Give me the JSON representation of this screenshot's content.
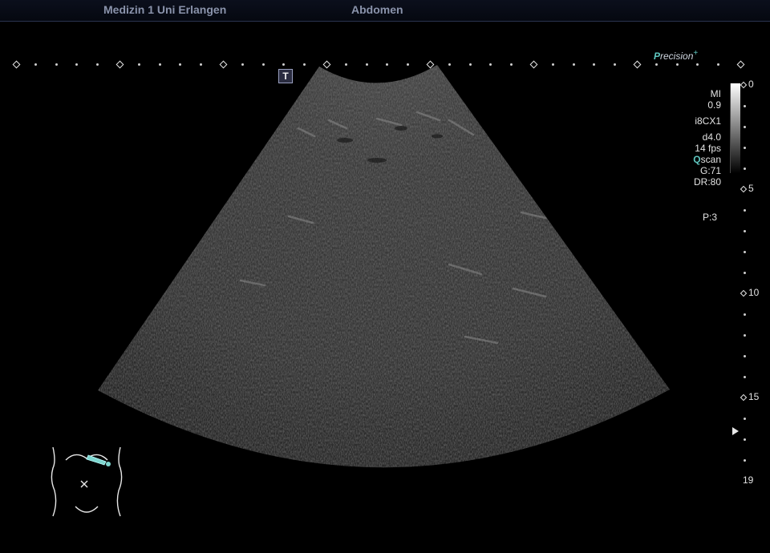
{
  "header": {
    "institution": "Medizin 1 Uni Erlangen",
    "preset": "Abdomen"
  },
  "branding": {
    "precision_first": "P",
    "precision_rest": "recision",
    "precision_plus": "+"
  },
  "tool_marker": "T",
  "parameters": {
    "mi_label": "MI",
    "mi_value": "0.9",
    "probe": "i8CX1",
    "depth": "d4.0",
    "frame_rate": "14 fps",
    "scan_q": "Q",
    "scan_rest": "scan",
    "gain": "G:71",
    "dynamic_range": "DR:80",
    "persistence": "P:3"
  },
  "depth_scale": {
    "labels": [
      "0",
      "5",
      "10",
      "15",
      "19"
    ],
    "unit_ticks": 19
  },
  "icons": [
    "tool-marker-icon",
    "focus-marker-icon",
    "body-mark-icon",
    "probe-position-icon"
  ],
  "colors": {
    "accent": "#5fc7c0",
    "header_text": "#8a93ab",
    "background": "#000000"
  }
}
